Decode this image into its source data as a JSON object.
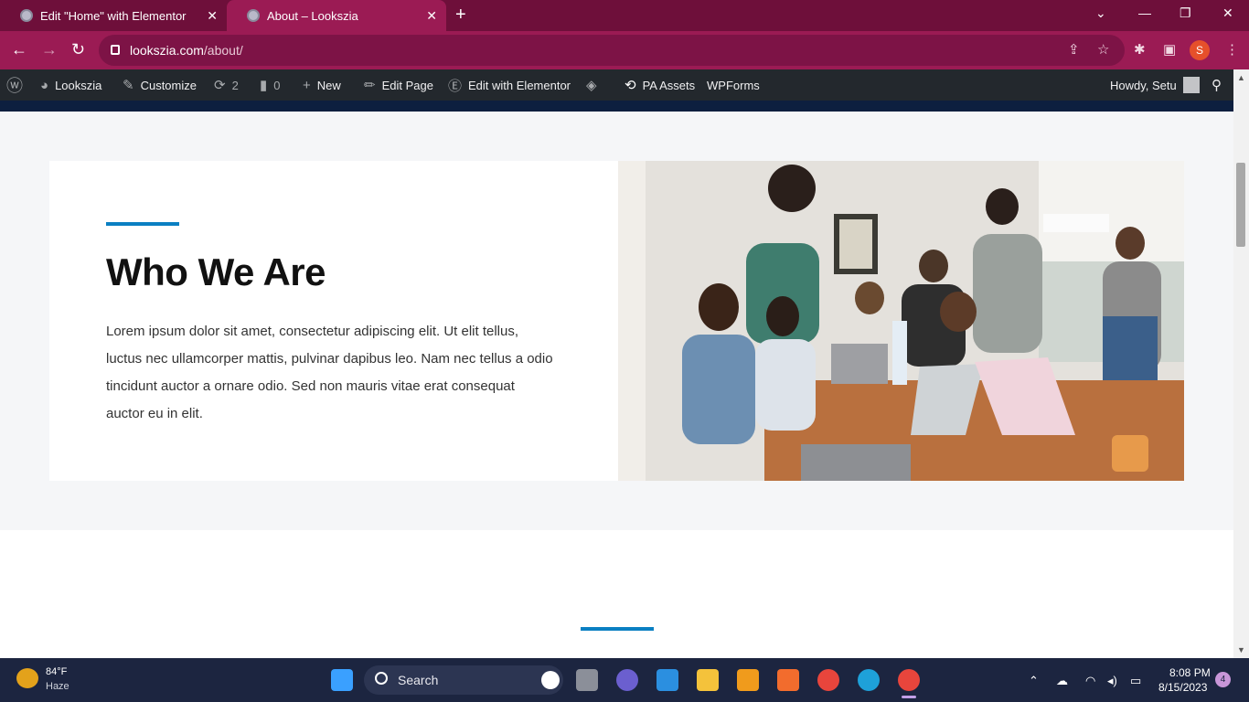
{
  "browser": {
    "tabs": [
      {
        "title": "Edit \"Home\" with Elementor"
      },
      {
        "title": "About – Lookszia"
      }
    ],
    "url_host": "lookszia.com",
    "url_path": "/about/",
    "profile_initial": "S"
  },
  "adminbar": {
    "site": "Lookszia",
    "customize": "Customize",
    "updates_count": "2",
    "comments_count": "0",
    "new": "New",
    "edit_page": "Edit Page",
    "edit_elementor": "Edit with Elementor",
    "pa_assets": "PA Assets",
    "wpforms": "WPForms",
    "howdy": "Howdy, Setu"
  },
  "page": {
    "heading": "Who We Are",
    "paragraph": "Lorem ipsum dolor sit amet, consectetur adipiscing elit. Ut elit tellus, luctus nec ullamcorper mattis, pulvinar dapibus leo. Nam nec tellus a odio tincidunt auctor a ornare odio. Sed non mauris vitae erat consequat auctor eu in elit.",
    "accent_color": "#0a7fc2"
  },
  "taskbar": {
    "temperature": "84°F",
    "condition": "Haze",
    "search_label": "Search",
    "time": "8:08 PM",
    "date": "8/15/2023",
    "notification_count": "4"
  }
}
